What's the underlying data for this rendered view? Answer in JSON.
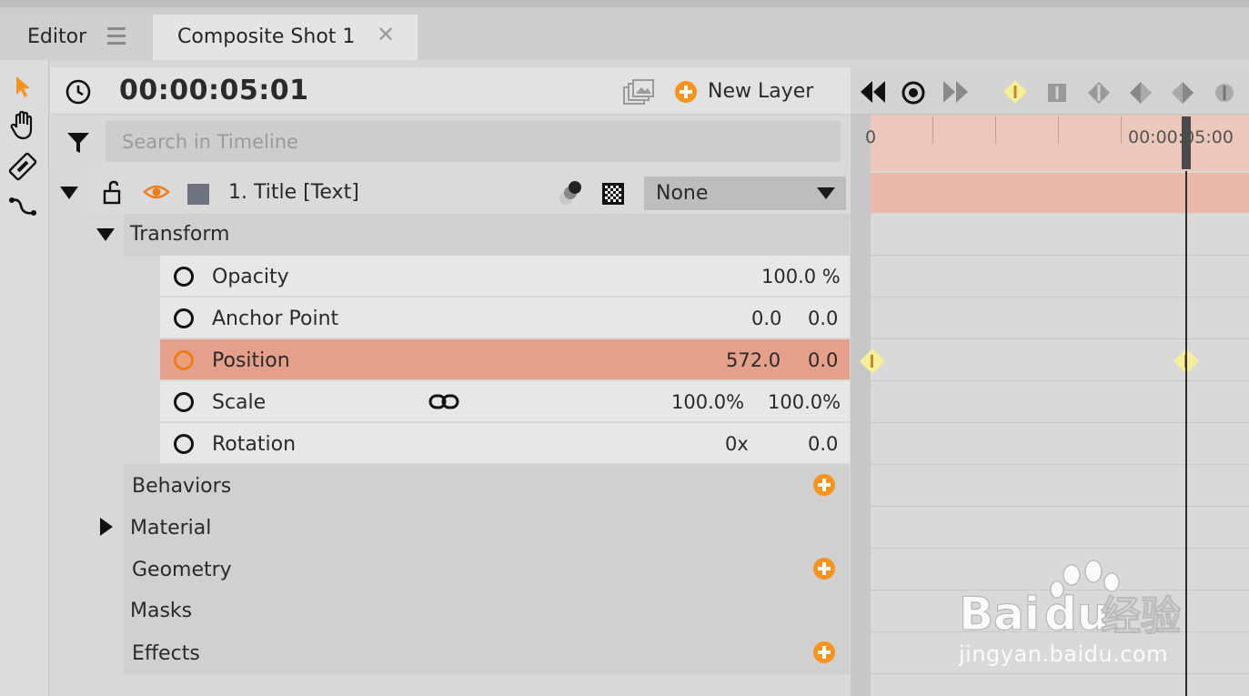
{
  "tabs": [
    {
      "label": "Editor"
    },
    {
      "label": "Composite Shot 1"
    }
  ],
  "timeline": {
    "timecode": "00:00:05:01",
    "new_layer_label": "New Layer",
    "search_placeholder": "Search in Timeline"
  },
  "layer": {
    "name": "1. Title [Text]",
    "blend_mode": "None"
  },
  "transform": {
    "label": "Transform",
    "properties": [
      {
        "name": "Opacity",
        "values": [
          "100.0 %"
        ]
      },
      {
        "name": "Anchor Point",
        "values": [
          "0.0",
          "0.0"
        ]
      },
      {
        "name": "Position",
        "values": [
          "572.0",
          "0.0"
        ],
        "selected": true
      },
      {
        "name": "Scale",
        "values": [
          "100.0%",
          "100.0%"
        ]
      },
      {
        "name": "Rotation",
        "values": [
          "0x",
          "0.0"
        ]
      }
    ]
  },
  "groups": [
    {
      "label": "Behaviors"
    },
    {
      "label": "Material"
    },
    {
      "label": "Geometry"
    },
    {
      "label": "Masks"
    },
    {
      "label": "Effects"
    }
  ],
  "ruler": {
    "start": "0",
    "end": "00:00:05:00"
  },
  "watermark": {
    "brand_a": "Bai",
    "brand_b": "du",
    "brand_c": "经验",
    "url": "jingyan.baidu.com"
  },
  "colors": {
    "accent": "#f7931e",
    "selected_row": "#e5a08c",
    "keyframe": "#f6ef9a",
    "ruler": "#ebc7bc"
  }
}
